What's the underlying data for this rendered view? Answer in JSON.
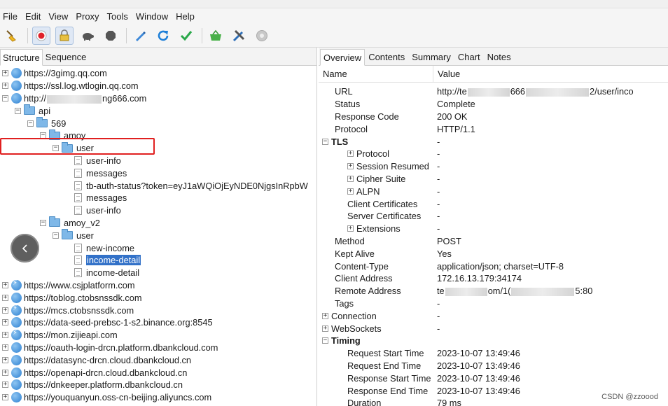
{
  "menu": [
    "File",
    "Edit",
    "View",
    "Proxy",
    "Tools",
    "Window",
    "Help"
  ],
  "toolbar": {
    "icons": [
      "broom-icon",
      "record-icon",
      "lock-icon",
      "turtle-icon",
      "stop-icon",
      "pen-icon",
      "refresh-icon",
      "check-icon",
      "basket-icon",
      "tools-icon",
      "settings-icon"
    ]
  },
  "left_tabs": [
    "Structure",
    "Sequence"
  ],
  "tree": [
    {
      "depth": 0,
      "exp": "+",
      "icon": "globe",
      "label": "https://3gimg.qq.com"
    },
    {
      "depth": 0,
      "exp": "+",
      "icon": "globe",
      "label": "https://ssl.log.wtlogin.qq.com"
    },
    {
      "depth": 0,
      "exp": "−",
      "icon": "globe",
      "label_pre": "http://",
      "label_post": "ng666.com",
      "redacted": true
    },
    {
      "depth": 1,
      "exp": "−",
      "icon": "folder",
      "label": "api"
    },
    {
      "depth": 2,
      "exp": "−",
      "icon": "folder",
      "label": "569"
    },
    {
      "depth": 3,
      "exp": "−",
      "icon": "folder",
      "label": "amoy"
    },
    {
      "depth": 4,
      "exp": "−",
      "icon": "folder",
      "label": "user"
    },
    {
      "depth": 5,
      "exp": "",
      "icon": "doc",
      "label": "user-info"
    },
    {
      "depth": 5,
      "exp": "",
      "icon": "doc",
      "label": "messages"
    },
    {
      "depth": 5,
      "exp": "",
      "icon": "doc",
      "label": "tb-auth-status?token=eyJ1aWQiOjEyNDE0NjgsInRpbW"
    },
    {
      "depth": 5,
      "exp": "",
      "icon": "doc",
      "label": "messages"
    },
    {
      "depth": 5,
      "exp": "",
      "icon": "doc",
      "label": "user-info"
    },
    {
      "depth": 3,
      "exp": "−",
      "icon": "folder",
      "label": "amoy_v2"
    },
    {
      "depth": 4,
      "exp": "−",
      "icon": "folder",
      "label": "user"
    },
    {
      "depth": 5,
      "exp": "",
      "icon": "doc",
      "label": "new-income"
    },
    {
      "depth": 5,
      "exp": "",
      "icon": "doc",
      "label": "income-detail",
      "selected": true
    },
    {
      "depth": 5,
      "exp": "",
      "icon": "doc",
      "label": "income-detail"
    },
    {
      "depth": 0,
      "exp": "+",
      "icon": "globe-bolt",
      "label": "https://www.csjplatform.com"
    },
    {
      "depth": 0,
      "exp": "+",
      "icon": "globe",
      "label": "https://toblog.ctobsnssdk.com"
    },
    {
      "depth": 0,
      "exp": "+",
      "icon": "globe-bolt",
      "label": "https://mcs.ctobsnssdk.com"
    },
    {
      "depth": 0,
      "exp": "+",
      "icon": "globe",
      "label": "https://data-seed-prebsc-1-s2.binance.org:8545"
    },
    {
      "depth": 0,
      "exp": "+",
      "icon": "globe-bolt",
      "label": "https://mon.zijieapi.com"
    },
    {
      "depth": 0,
      "exp": "+",
      "icon": "globe",
      "label": "https://oauth-login-drcn.platform.dbankcloud.com"
    },
    {
      "depth": 0,
      "exp": "+",
      "icon": "globe",
      "label": "https://datasync-drcn.cloud.dbankcloud.cn"
    },
    {
      "depth": 0,
      "exp": "+",
      "icon": "globe",
      "label": "https://openapi-drcn.cloud.dbankcloud.cn"
    },
    {
      "depth": 0,
      "exp": "+",
      "icon": "globe",
      "label": "https://dnkeeper.platform.dbankcloud.cn"
    },
    {
      "depth": 0,
      "exp": "+",
      "icon": "globe",
      "label": "https://youquanyun.oss-cn-beijing.aliyuncs.com"
    }
  ],
  "right_tabs": [
    "Overview",
    "Contents",
    "Summary",
    "Chart",
    "Notes"
  ],
  "table_header": {
    "name": "Name",
    "value": "Value"
  },
  "props": [
    {
      "d": 1,
      "exp": "",
      "name": "URL",
      "value": "http://te",
      "value_tail": "666",
      "value_end": "2/user/inco",
      "redacted": true
    },
    {
      "d": 1,
      "exp": "",
      "name": "Status",
      "value": "Complete"
    },
    {
      "d": 1,
      "exp": "",
      "name": "Response Code",
      "value": "200 OK"
    },
    {
      "d": 1,
      "exp": "",
      "name": "Protocol",
      "value": "HTTP/1.1"
    },
    {
      "d": 0,
      "exp": "−",
      "name": "TLS",
      "value": "-",
      "bold": true
    },
    {
      "d": 2,
      "exp": "+",
      "name": "Protocol",
      "value": "-"
    },
    {
      "d": 2,
      "exp": "+",
      "name": "Session Resumed",
      "value": "-"
    },
    {
      "d": 2,
      "exp": "+",
      "name": "Cipher Suite",
      "value": "-"
    },
    {
      "d": 2,
      "exp": "+",
      "name": "ALPN",
      "value": "-"
    },
    {
      "d": 2,
      "exp": "",
      "name": "Client Certificates",
      "value": "-"
    },
    {
      "d": 2,
      "exp": "",
      "name": "Server Certificates",
      "value": "-"
    },
    {
      "d": 2,
      "exp": "+",
      "name": "Extensions",
      "value": "-"
    },
    {
      "d": 1,
      "exp": "",
      "name": "Method",
      "value": "POST"
    },
    {
      "d": 1,
      "exp": "",
      "name": "Kept Alive",
      "value": "Yes"
    },
    {
      "d": 1,
      "exp": "",
      "name": "Content-Type",
      "value": "application/json; charset=UTF-8"
    },
    {
      "d": 1,
      "exp": "",
      "name": "Client Address",
      "value": "172.16.13.179:34174"
    },
    {
      "d": 1,
      "exp": "",
      "name": "Remote Address",
      "value": "te",
      "value_tail": "om/1(",
      "value_end": "5:80",
      "redacted": true
    },
    {
      "d": 1,
      "exp": "",
      "name": "Tags",
      "value": "-"
    },
    {
      "d": 0,
      "exp": "+",
      "name": "Connection",
      "value": "-"
    },
    {
      "d": 0,
      "exp": "+",
      "name": "WebSockets",
      "value": "-"
    },
    {
      "d": 0,
      "exp": "−",
      "name": "Timing",
      "value": "",
      "bold": true
    },
    {
      "d": 2,
      "exp": "",
      "name": "Request Start Time",
      "value": "2023-10-07 13:49:46"
    },
    {
      "d": 2,
      "exp": "",
      "name": "Request End Time",
      "value": "2023-10-07 13:49:46"
    },
    {
      "d": 2,
      "exp": "",
      "name": "Response Start Time",
      "value": "2023-10-07 13:49:46"
    },
    {
      "d": 2,
      "exp": "",
      "name": "Response End Time",
      "value": "2023-10-07 13:49:46"
    },
    {
      "d": 2,
      "exp": "",
      "name": "Duration",
      "value": "79 ms"
    }
  ],
  "watermark": "CSDN @zzoood"
}
